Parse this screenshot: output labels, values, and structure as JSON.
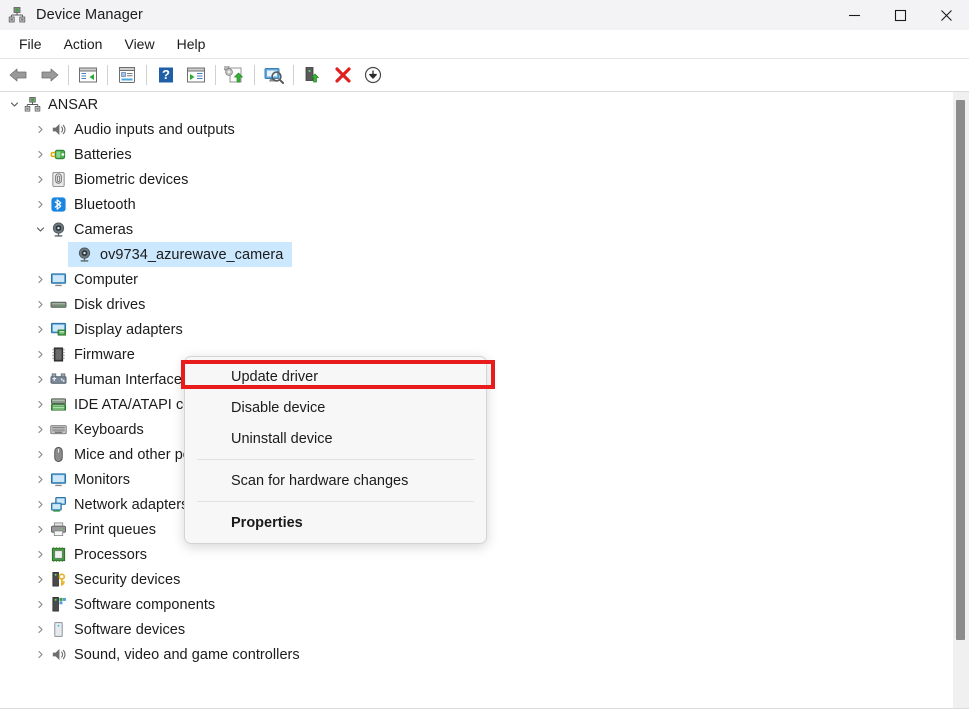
{
  "window": {
    "title": "Device Manager",
    "icon": "device-manager-icon",
    "controls": {
      "minimize": "minimize-icon",
      "maximize": "maximize-icon",
      "close": "close-icon"
    }
  },
  "menubar": {
    "items": [
      {
        "label": "File"
      },
      {
        "label": "Action"
      },
      {
        "label": "View"
      },
      {
        "label": "Help"
      }
    ]
  },
  "toolbar": {
    "buttons": [
      {
        "name": "back-icon"
      },
      {
        "name": "forward-icon"
      },
      {
        "name": "show-hide-console-tree-icon"
      },
      {
        "name": "properties-icon"
      },
      {
        "name": "help-icon"
      },
      {
        "name": "show-hide-action-pane-icon"
      },
      {
        "name": "update-driver-icon"
      },
      {
        "name": "scan-for-hardware-changes-icon"
      },
      {
        "name": "enable-device-icon"
      },
      {
        "name": "uninstall-device-icon"
      },
      {
        "name": "disable-device-icon"
      }
    ]
  },
  "tree": {
    "nodes": [
      {
        "label": "ANSAR",
        "level": 0,
        "expanded": true,
        "icon": "computer-root-icon",
        "selected": false
      },
      {
        "label": "Audio inputs and outputs",
        "level": 1,
        "expanded": false,
        "icon": "speaker-icon",
        "selected": false
      },
      {
        "label": "Batteries",
        "level": 1,
        "expanded": false,
        "icon": "battery-icon",
        "selected": false
      },
      {
        "label": "Biometric devices",
        "level": 1,
        "expanded": false,
        "icon": "fingerprint-icon",
        "selected": false
      },
      {
        "label": "Bluetooth",
        "level": 1,
        "expanded": false,
        "icon": "bluetooth-icon",
        "selected": false
      },
      {
        "label": "Cameras",
        "level": 1,
        "expanded": true,
        "icon": "camera-icon",
        "selected": false
      },
      {
        "label": "ov9734_azurewave_camera",
        "level": 2,
        "expanded": null,
        "icon": "camera-icon",
        "selected": true
      },
      {
        "label": "Computer",
        "level": 1,
        "expanded": false,
        "icon": "monitor-icon",
        "selected": false
      },
      {
        "label": "Disk drives",
        "level": 1,
        "expanded": false,
        "icon": "disk-drive-icon",
        "selected": false
      },
      {
        "label": "Display adapters",
        "level": 1,
        "expanded": false,
        "icon": "display-adapter-icon",
        "selected": false
      },
      {
        "label": "Firmware",
        "level": 1,
        "expanded": false,
        "icon": "firmware-chip-icon",
        "selected": false
      },
      {
        "label": "Human Interface Devices",
        "level": 1,
        "expanded": false,
        "icon": "hid-icon",
        "selected": false
      },
      {
        "label": "IDE ATA/ATAPI controllers",
        "level": 1,
        "expanded": false,
        "icon": "ide-controller-icon",
        "selected": false
      },
      {
        "label": "Keyboards",
        "level": 1,
        "expanded": false,
        "icon": "keyboard-icon",
        "selected": false
      },
      {
        "label": "Mice and other pointing devices",
        "level": 1,
        "expanded": false,
        "icon": "mouse-icon",
        "selected": false
      },
      {
        "label": "Monitors",
        "level": 1,
        "expanded": false,
        "icon": "monitor-icon",
        "selected": false
      },
      {
        "label": "Network adapters",
        "level": 1,
        "expanded": false,
        "icon": "network-adapter-icon",
        "selected": false
      },
      {
        "label": "Print queues",
        "level": 1,
        "expanded": false,
        "icon": "printer-icon",
        "selected": false
      },
      {
        "label": "Processors",
        "level": 1,
        "expanded": false,
        "icon": "processor-icon",
        "selected": false
      },
      {
        "label": "Security devices",
        "level": 1,
        "expanded": false,
        "icon": "security-key-icon",
        "selected": false
      },
      {
        "label": "Software components",
        "level": 1,
        "expanded": false,
        "icon": "software-component-icon",
        "selected": false
      },
      {
        "label": "Software devices",
        "level": 1,
        "expanded": false,
        "icon": "software-device-icon",
        "selected": false
      },
      {
        "label": "Sound, video and game controllers",
        "level": 1,
        "expanded": false,
        "icon": "speaker-icon",
        "selected": false
      }
    ]
  },
  "context_menu": {
    "items": [
      {
        "label": "Update driver",
        "bold": false,
        "highlighted": true
      },
      {
        "label": "Disable device",
        "bold": false,
        "highlighted": false
      },
      {
        "label": "Uninstall device",
        "bold": false,
        "highlighted": false
      },
      {
        "separator": true
      },
      {
        "label": "Scan for hardware changes",
        "bold": false,
        "highlighted": false
      },
      {
        "separator": true
      },
      {
        "label": "Properties",
        "bold": true,
        "highlighted": false
      }
    ]
  },
  "colors": {
    "highlight_box": "#e81c1c",
    "selection": "#cce8ff",
    "titlebar": "#f3f3f6",
    "menu_bg": "#f7f7f7"
  }
}
